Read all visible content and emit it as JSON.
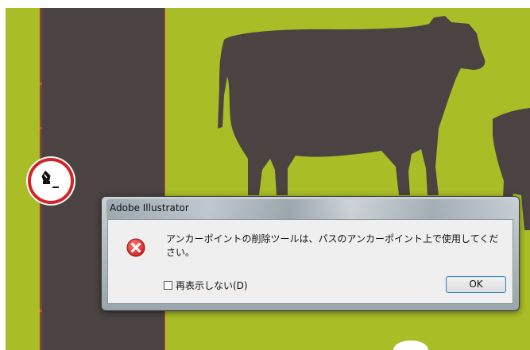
{
  "colors": {
    "background": "#a9bd27",
    "shape": "#4b4341",
    "path": "#e8402a",
    "highlight": "#d0262a"
  },
  "canvas": {
    "pen_cursor_icon": "delete-anchor-point-pen-icon"
  },
  "dialog": {
    "title": "Adobe Illustrator",
    "icon": "error-icon",
    "message": "アンカーポイントの削除ツールは、パスのアンカーポイント上で使用してください。",
    "checkbox_label": "再表示しない(D)",
    "checkbox_checked": false,
    "ok_label": "OK"
  }
}
